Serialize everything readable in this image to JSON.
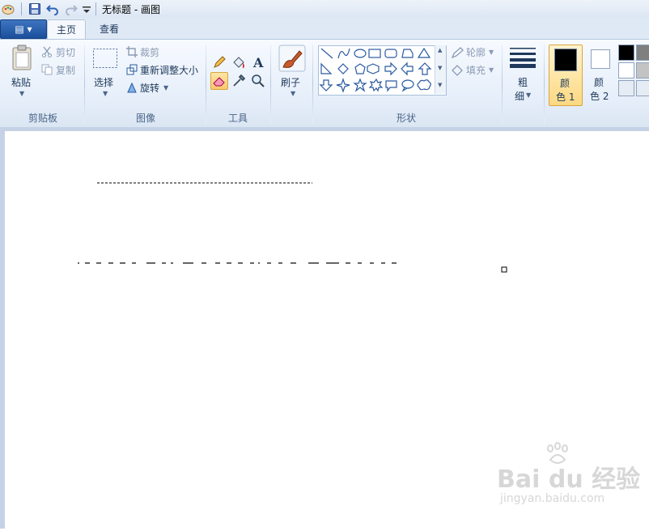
{
  "titlebar": {
    "title": "无标题 - 画图"
  },
  "tabs": {
    "app_menu_label": "▤ ▾",
    "home": "主页",
    "view": "查看"
  },
  "clipboard": {
    "paste": "粘贴",
    "cut": "剪切",
    "copy": "复制",
    "group": "剪贴板"
  },
  "image": {
    "select": "选择",
    "crop": "裁剪",
    "resize": "重新调整大小",
    "rotate": "旋转",
    "group": "图像"
  },
  "tools": {
    "group": "工具"
  },
  "brushes": {
    "label": "刷子"
  },
  "shapes": {
    "outline": "轮廓",
    "fill": "填充",
    "group": "形状"
  },
  "size": {
    "label_1": "粗",
    "label_2": "细"
  },
  "colors": {
    "color1_a": "颜",
    "color1_b": "色 1",
    "color2_a": "颜",
    "color2_b": "色 2",
    "palette": [
      "#000000",
      "#7f7f7f",
      "#ffffff",
      "#c3c3c3",
      "#e6ecf4",
      "#e6ecf4"
    ]
  },
  "canvas": {
    "background": "#ffffff"
  },
  "watermark": {
    "brand": "Bai du 经验",
    "url": "jingyan.baidu.com"
  }
}
